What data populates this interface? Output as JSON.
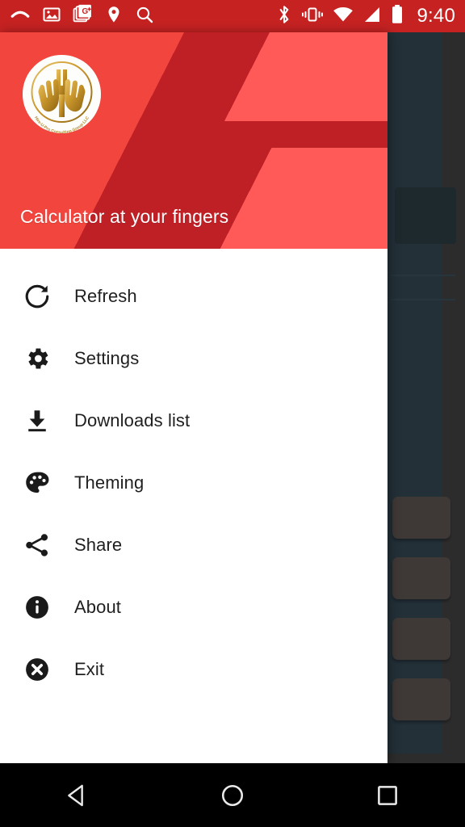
{
  "status_bar": {
    "background_color": "#c62222",
    "time": "9:40",
    "left_icons": [
      {
        "name": "call-missed-icon",
        "label": "Missed call"
      },
      {
        "name": "image-icon",
        "label": "Screenshot"
      },
      {
        "name": "google-plus-icon",
        "label": "Google Plus"
      },
      {
        "name": "location-pin-icon",
        "label": "Location"
      },
      {
        "name": "search-icon",
        "label": "Search"
      }
    ],
    "right_icons": [
      {
        "name": "bluetooth-icon",
        "label": "Bluetooth"
      },
      {
        "name": "vibrate-icon",
        "label": "Vibrate"
      },
      {
        "name": "wifi-icon",
        "label": "Wi-Fi"
      },
      {
        "name": "signal-icon",
        "label": "Cellular signal"
      },
      {
        "name": "battery-icon",
        "label": "Battery"
      }
    ]
  },
  "drawer": {
    "header": {
      "title": "Calculator at your fingers",
      "base_color": "#f1453d",
      "dark_band_color": "#bf2026",
      "light_band_color": "#ff5a57",
      "logo": {
        "name": "helping-hands-logo",
        "caption": "Hire-U-Pro Consulting Group LLC",
        "gold_color": "#c99a2e",
        "background_color": "#fdfdfb"
      }
    },
    "menu_items": [
      {
        "label": "Refresh",
        "icon": "refresh-icon"
      },
      {
        "label": "Settings",
        "icon": "gear-icon"
      },
      {
        "label": "Downloads list",
        "icon": "download-icon"
      },
      {
        "label": "Theming",
        "icon": "palette-icon"
      },
      {
        "label": "Share",
        "icon": "share-icon"
      },
      {
        "label": "About",
        "icon": "info-circle-icon"
      },
      {
        "label": "Exit",
        "icon": "close-circle-icon"
      }
    ]
  },
  "background_app": {
    "panel_color": "#3d5361",
    "scrim_color": "#4d4d4d",
    "button_color": "#6b6160",
    "card_color": "#35474f"
  },
  "nav_bar": {
    "background_color": "#000000",
    "buttons": [
      {
        "name": "back-button",
        "label": "Back"
      },
      {
        "name": "home-button",
        "label": "Home"
      },
      {
        "name": "recents-button",
        "label": "Recents"
      }
    ]
  }
}
